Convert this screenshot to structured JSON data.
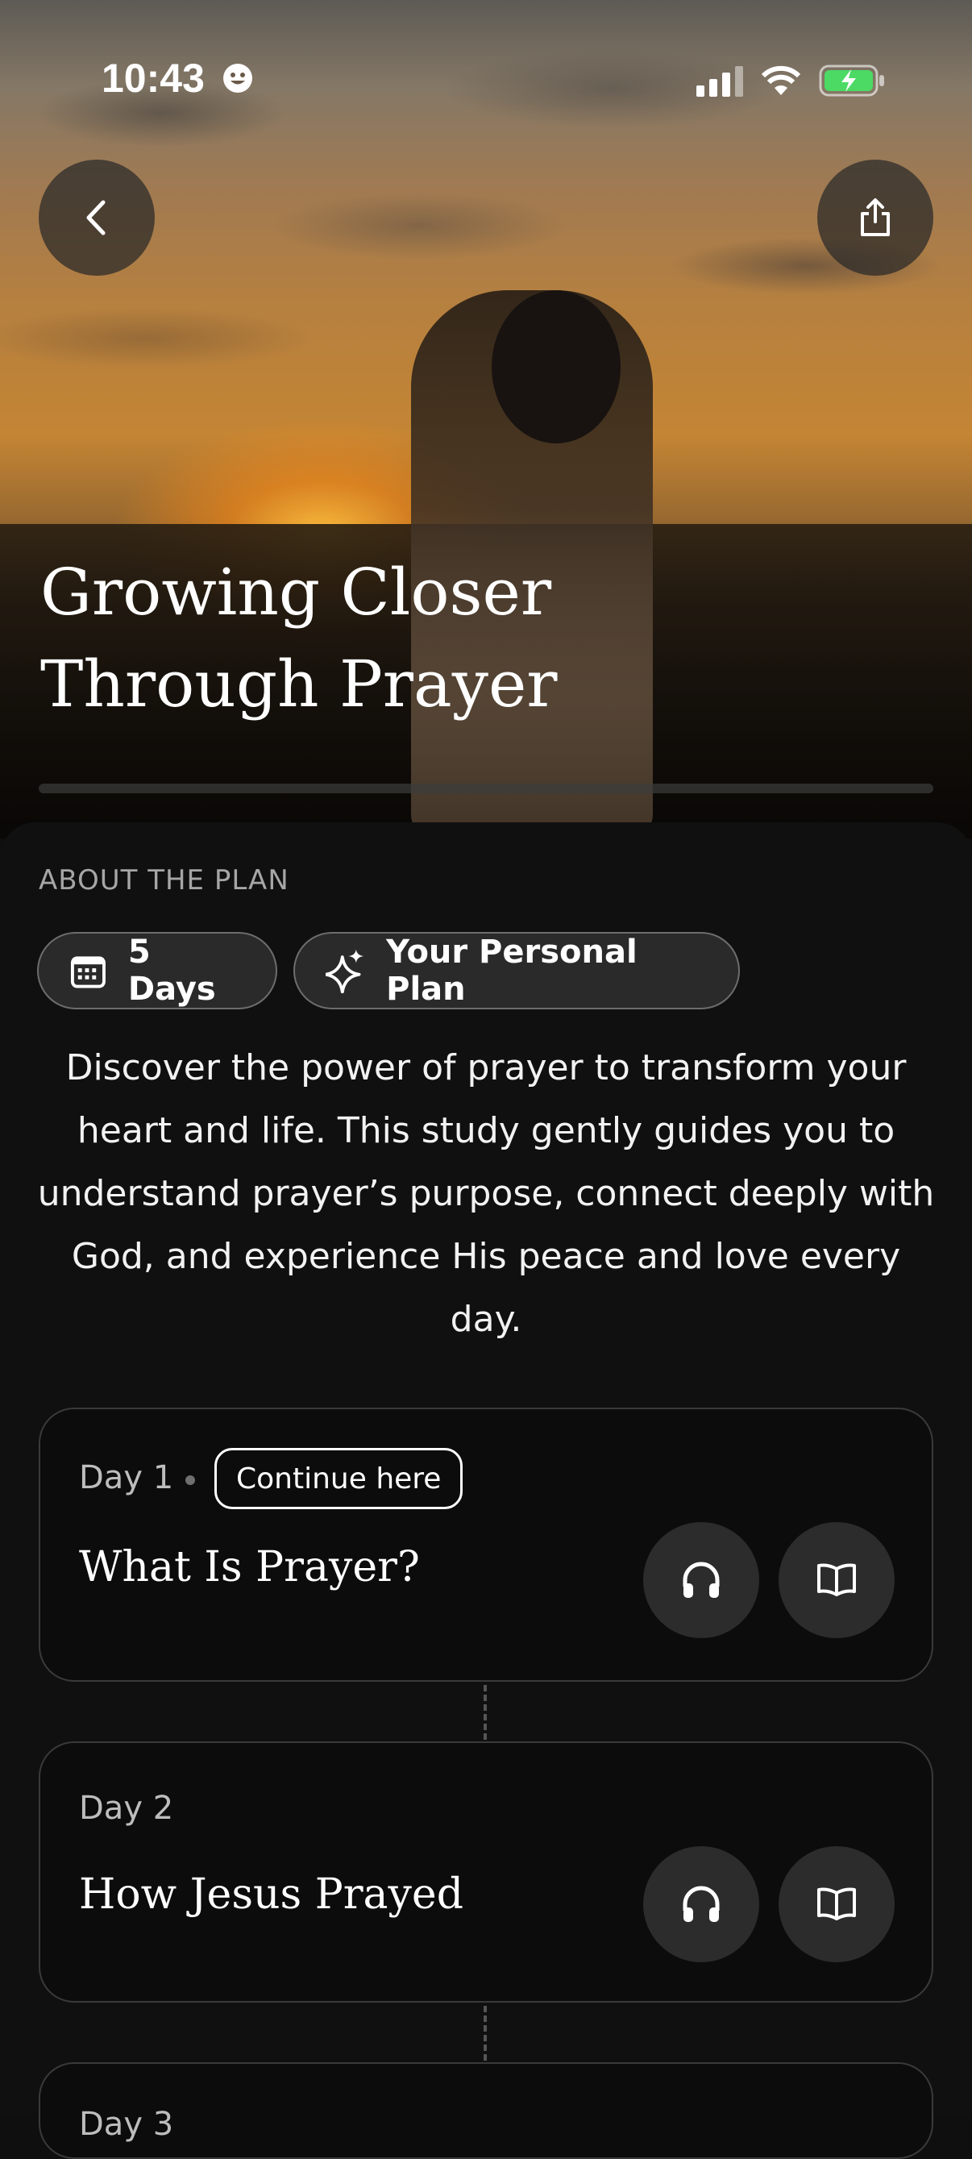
{
  "status_bar": {
    "time": "10:43"
  },
  "hero": {
    "title_line1": "Growing Closer",
    "title_line2": "Through Prayer",
    "progress_fraction": 0.0
  },
  "icons": {
    "back": "chevron-left-icon",
    "share": "share-icon",
    "calendar": "calendar-icon",
    "sparkles": "sparkles-icon",
    "listen": "headphones-icon",
    "read": "book-icon"
  },
  "about": {
    "heading": "ABOUT THE PLAN",
    "chips": {
      "days": "5 Days",
      "personal": "Your Personal Plan"
    },
    "description": "Discover the power of prayer to transform your heart and life. This study gently guides you to understand prayer’s purpose, connect deeply with God, and experience His peace and love every day."
  },
  "days": [
    {
      "label": "Day 1",
      "badge": "Continue here",
      "title": "What Is Prayer?"
    },
    {
      "label": "Day 2",
      "title": "How Jesus Prayed"
    },
    {
      "label": "Day 3"
    }
  ],
  "colors": {
    "background": "#0f0f0f",
    "card": "#0c0c0c",
    "card_border": "#3a3a3a",
    "chip_bg": "#2a2a2a",
    "icon_button": "#2c2c2c",
    "battery_green": "#4cd964"
  }
}
